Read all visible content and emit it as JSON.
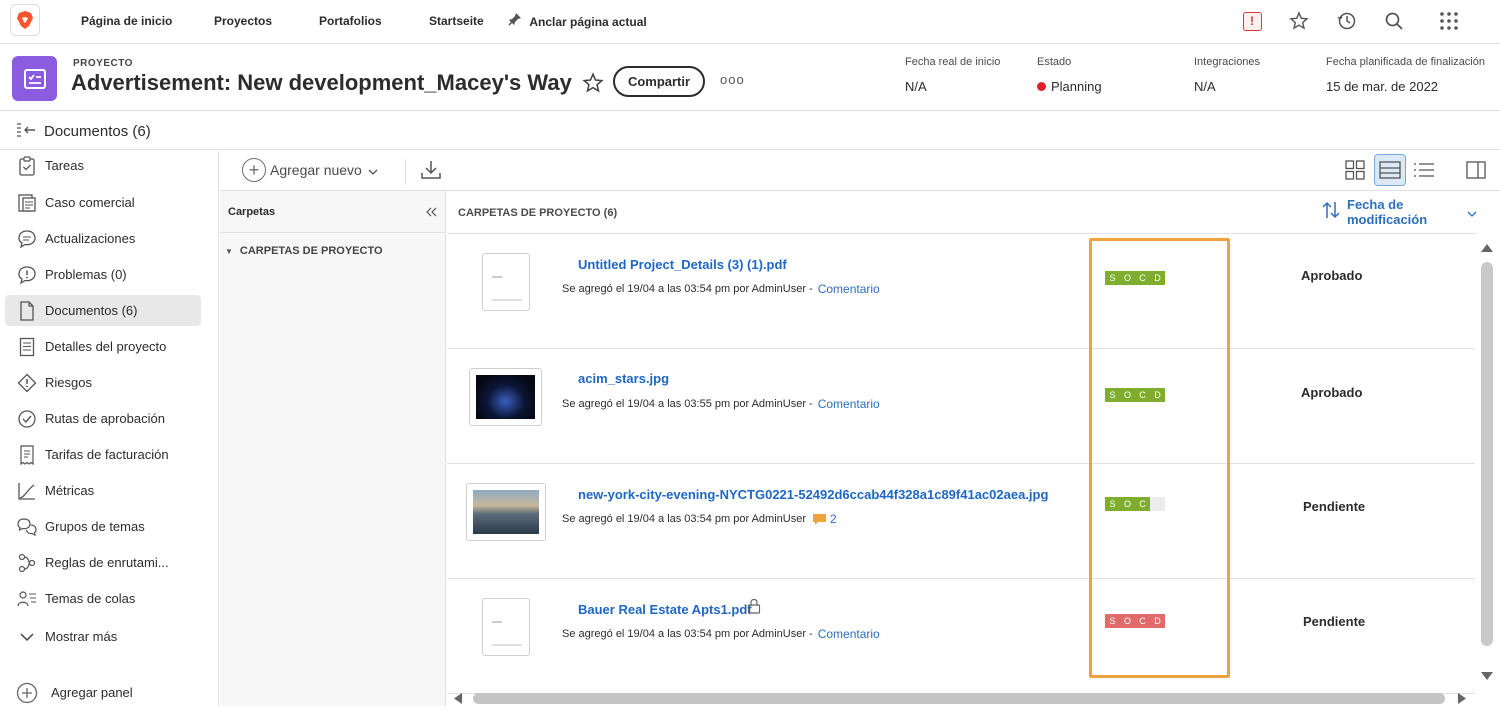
{
  "topnav": {
    "items": [
      "Página de inicio",
      "Proyectos",
      "Portafolios",
      "Startseite",
      "Anclar página actual"
    ],
    "icons": [
      "alert-icon",
      "star-icon",
      "history-icon",
      "search-icon",
      "apps-grid-icon"
    ],
    "alert_glyph": "!"
  },
  "header": {
    "label": "PROYECTO",
    "title": "Advertisement: New development_Macey's Way",
    "share": "Compartir",
    "more": "ooo",
    "meta": [
      {
        "label": "Fecha real de inicio",
        "value": "N/A"
      },
      {
        "label": "Estado",
        "value": "Planning",
        "dot_color": "#e0212d"
      },
      {
        "label": "Integraciones",
        "value": "N/A"
      },
      {
        "label": "Fecha planificada de finalización",
        "value": "15 de mar. de 2022"
      }
    ]
  },
  "subheader": {
    "title": "Documentos (6)"
  },
  "sidebar": {
    "items": [
      {
        "label": "Tareas",
        "icon": "clipboard-icon"
      },
      {
        "label": "Caso comercial",
        "icon": "business-case-icon"
      },
      {
        "label": "Actualizaciones",
        "icon": "chat-bubble-icon"
      },
      {
        "label": "Problemas (0)",
        "icon": "issue-bubble-icon"
      },
      {
        "label": "Documentos (6)",
        "icon": "document-icon",
        "active": true
      },
      {
        "label": "Detalles del proyecto",
        "icon": "details-icon"
      },
      {
        "label": "Riesgos",
        "icon": "risk-diamond-icon"
      },
      {
        "label": "Rutas de aprobación",
        "icon": "check-circle-icon"
      },
      {
        "label": "Tarifas de facturación",
        "icon": "billing-icon"
      },
      {
        "label": "Métricas",
        "icon": "metrics-curve-icon"
      },
      {
        "label": "Grupos de temas",
        "icon": "topic-groups-icon"
      },
      {
        "label": "Reglas de enrutami...",
        "icon": "routing-icon"
      },
      {
        "label": "Temas de colas",
        "icon": "queue-topics-icon"
      },
      {
        "label": "Mostrar más",
        "icon": "chevron-down-icon"
      }
    ],
    "add_panel": "Agregar panel"
  },
  "toolbar": {
    "add_new": "Agregar nuevo",
    "add_plus": "+"
  },
  "folders": {
    "title": "Carpetas",
    "item": "CARPETAS DE PROYECTO"
  },
  "list": {
    "title": "CARPETAS DE PROYECTO (6)",
    "sort": "Fecha de modificación",
    "rows": [
      {
        "name": "Untitled Project_Details (3) (1).pdf",
        "info": "Se agregó el 19/04 a las 03:54 pm por AdminUser -",
        "comment": "Comentario",
        "socd": [
          "S",
          "O",
          "C",
          "D"
        ],
        "socd_color": "#7fae2e",
        "status": "Aprobado",
        "thumb": "doc"
      },
      {
        "name": "acim_stars.jpg",
        "info": "Se agregó el 19/04 a las 03:55 pm por AdminUser -",
        "comment": "Comentario",
        "socd": [
          "S",
          "O",
          "C",
          "D"
        ],
        "socd_color": "#7fae2e",
        "status": "Aprobado",
        "thumb": "stars"
      },
      {
        "name": "new-york-city-evening-NYCTG0221-52492d6ccab44f328a1c89f41ac02aea.jpg",
        "info": "Se agregó el 19/04 a las 03:54 pm por AdminUser",
        "comment_count": "2",
        "socd": [
          "S",
          "O",
          "C"
        ],
        "socd_color": "#7fae2e",
        "status": "Pendiente",
        "thumb": "city"
      },
      {
        "name": "Bauer Real Estate Apts1.pdf",
        "info": "Se agregó el 19/04 a las 03:54 pm por AdminUser -",
        "comment": "Comentario",
        "socd": [
          "S",
          "O",
          "C",
          "D"
        ],
        "socd_color": "#e26a6a",
        "status": "Pendiente",
        "thumb": "doc",
        "locked": true
      }
    ]
  }
}
